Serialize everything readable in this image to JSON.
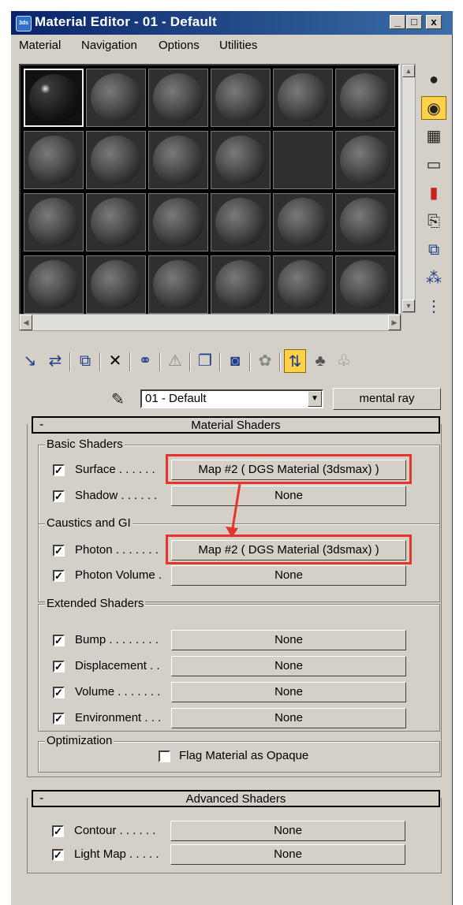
{
  "window": {
    "title": "Material Editor - 01 - Default",
    "app_icon": "3ds",
    "minimize": "_",
    "maximize": "□",
    "close": "x"
  },
  "menu": [
    "Material",
    "Navigation",
    "Options",
    "Utilities"
  ],
  "sample_slots": {
    "rows": 4,
    "cols": 6,
    "active_index": 0,
    "empty_index": 10
  },
  "side_tools": [
    "sample-type-icon",
    "backlight-icon",
    "background-checker-icon",
    "sample-uv-tiling-icon",
    "video-color-check-icon",
    "make-preview-icon",
    "options-icon",
    "select-by-material-icon",
    "material-map-navigator-icon"
  ],
  "bottom_tools": [
    "get-material-icon",
    "put-to-scene-icon",
    "assign-to-selection-icon",
    "reset-map-icon",
    "make-unique-icon",
    "put-to-library-icon",
    "material-id-channel-icon",
    "show-map-in-viewport-icon",
    "show-end-result-icon",
    "go-to-parent-icon",
    "go-forward-to-sibling-icon"
  ],
  "name_row": {
    "material_name": "01 - Default",
    "type_button": "mental ray"
  },
  "material_shaders": {
    "title": "Material Shaders",
    "collapse": "-",
    "basic": {
      "label": "Basic Shaders",
      "rows": [
        {
          "label": "Surface . . . . . . ",
          "value": "Map #2  ( DGS Material (3dsmax) )",
          "checked": true
        },
        {
          "label": "Shadow . . . . . . ",
          "value": "None",
          "checked": true
        }
      ]
    },
    "caustics": {
      "label": "Caustics and GI",
      "rows": [
        {
          "label": "Photon . . . . . . . ",
          "value": "Map #2  ( DGS Material (3dsmax) )",
          "checked": true
        },
        {
          "label": "Photon Volume . ",
          "value": "None",
          "checked": true
        }
      ]
    },
    "extended": {
      "label": "Extended Shaders",
      "rows": [
        {
          "label": "Bump . . . . . . . . ",
          "value": "None",
          "checked": true
        },
        {
          "label": "Displacement . . ",
          "value": "None",
          "checked": true
        },
        {
          "label": "Volume . . . . . . . ",
          "value": "None",
          "checked": true
        },
        {
          "label": "Environment . . . ",
          "value": "None",
          "checked": true
        }
      ]
    },
    "optimization": {
      "label": "Optimization",
      "flag_label": "Flag Material as Opaque",
      "flag_checked": false
    }
  },
  "advanced_shaders": {
    "title": "Advanced Shaders",
    "collapse": "-",
    "rows": [
      {
        "label": "Contour . . . . . . ",
        "value": "None",
        "checked": true
      },
      {
        "label": "Light Map . . . . . ",
        "value": "None",
        "checked": true
      }
    ]
  },
  "colors": {
    "title_bar": "#0a246a",
    "highlight": "#e8332a",
    "panel": "#d4d0c8",
    "active_tool": "#ffd24a"
  },
  "check_mark": "✓"
}
